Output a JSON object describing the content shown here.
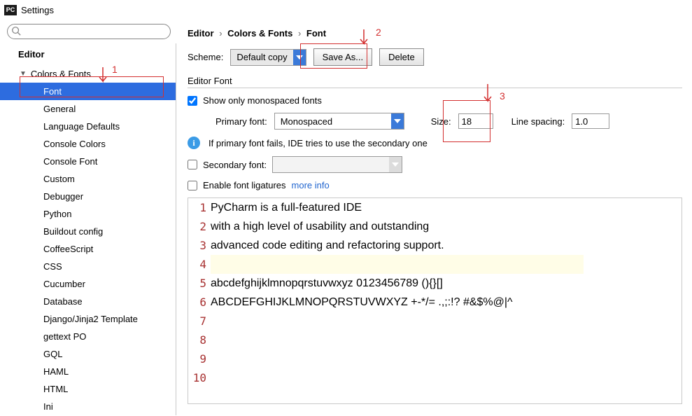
{
  "window_title": "Settings",
  "app_icon": "PC",
  "sidebar": {
    "header": "Editor",
    "group": "Colors & Fonts",
    "items": [
      "Font",
      "General",
      "Language Defaults",
      "Console Colors",
      "Console Font",
      "Custom",
      "Debugger",
      "Python",
      "Buildout config",
      "CoffeeScript",
      "CSS",
      "Cucumber",
      "Database",
      "Django/Jinja2 Template",
      "gettext PO",
      "GQL",
      "HAML",
      "HTML",
      "Ini"
    ],
    "selected_index": 0
  },
  "breadcrumb": {
    "a": "Editor",
    "b": "Colors & Fonts",
    "c": "Font"
  },
  "scheme": {
    "label": "Scheme:",
    "value": "Default copy",
    "save_as": "Save As...",
    "delete": "Delete"
  },
  "editor_font": {
    "section_label": "Editor Font",
    "show_only_mono_checked": true,
    "show_only_mono_label": "Show only monospaced fonts",
    "primary_label": "Primary font:",
    "primary_value": "Monospaced",
    "size_label": "Size:",
    "size_value": "18",
    "line_spacing_label": "Line spacing:",
    "line_spacing_value": "1.0",
    "fallback_info": "If primary font fails, IDE tries to use the secondary one",
    "secondary_label": "Secondary font:",
    "secondary_value": "",
    "ligatures_label": "Enable font ligatures",
    "ligatures_checked": false,
    "more_info": "more info"
  },
  "preview": {
    "lines": [
      "PyCharm is a full-featured IDE",
      "with a high level of usability and outstanding",
      "advanced code editing and refactoring support.",
      "",
      "abcdefghijklmnopqrstuvwxyz 0123456789 (){}[]",
      "ABCDEFGHIJKLMNOPQRSTUVWXYZ +-*/= .,;:!? #&$%@|^",
      "",
      "",
      "",
      ""
    ],
    "current_line_index": 3
  },
  "annotations": {
    "n1": "1",
    "n2": "2",
    "n3": "3"
  }
}
